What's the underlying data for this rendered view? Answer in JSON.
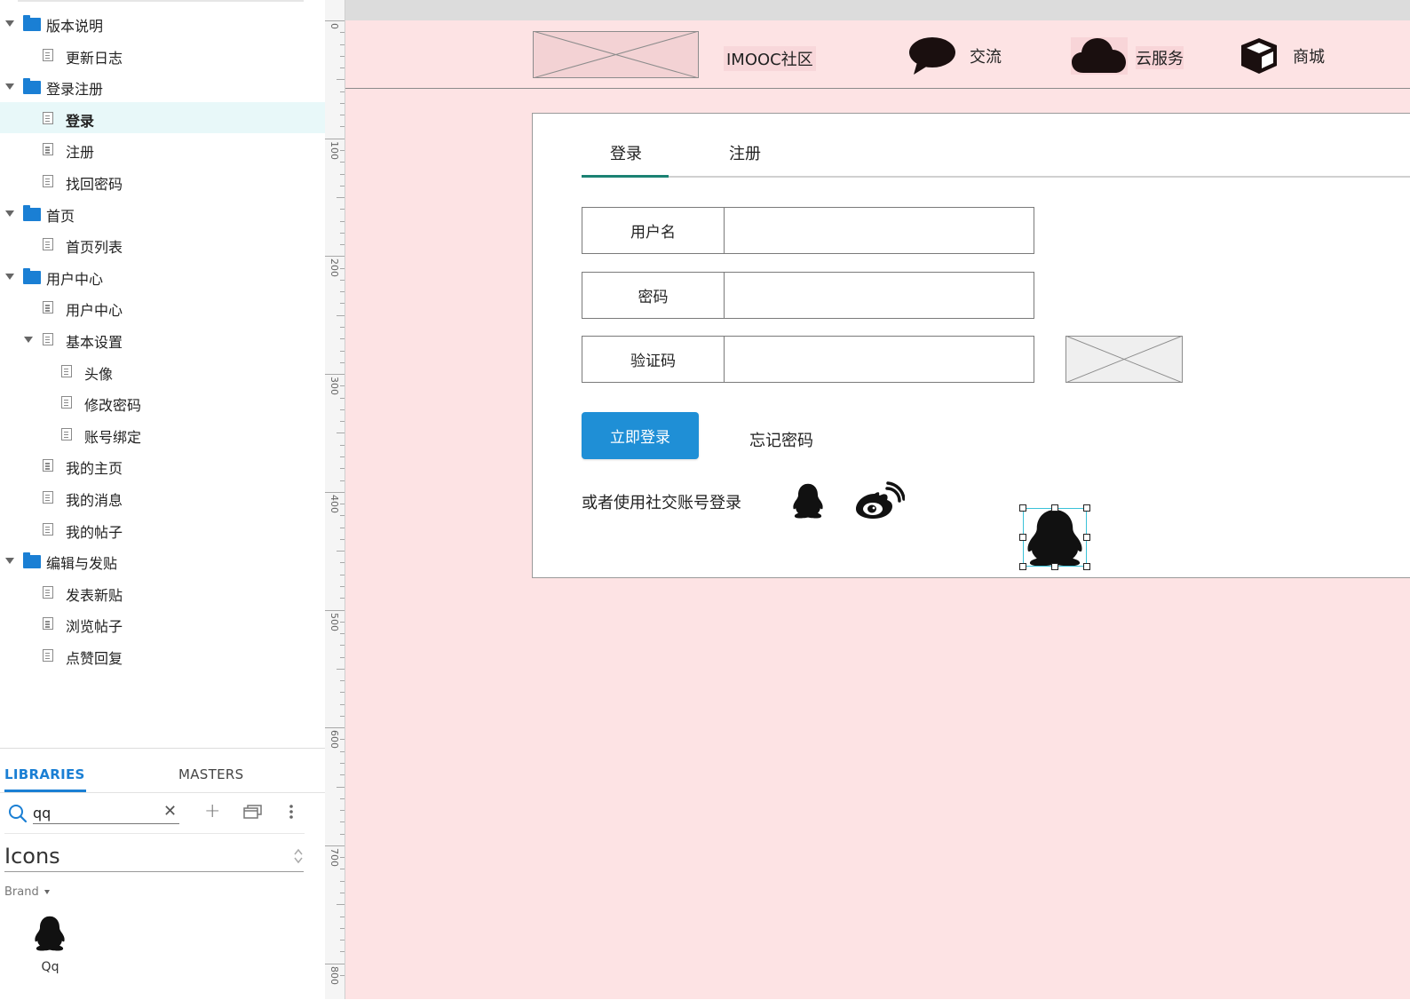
{
  "sidebar": {
    "tree": [
      {
        "label": "版本说明",
        "type": "folder",
        "level": 0,
        "expanded": true
      },
      {
        "label": "更新日志",
        "type": "page",
        "level": 1
      },
      {
        "label": "登录注册",
        "type": "folder",
        "level": 0,
        "expanded": true
      },
      {
        "label": "登录",
        "type": "page",
        "level": 1,
        "selected": true
      },
      {
        "label": "注册",
        "type": "page",
        "level": 1
      },
      {
        "label": "找回密码",
        "type": "page",
        "level": 1
      },
      {
        "label": "首页",
        "type": "folder",
        "level": 0,
        "expanded": true
      },
      {
        "label": "首页列表",
        "type": "page",
        "level": 1
      },
      {
        "label": "用户中心",
        "type": "folder",
        "level": 0,
        "expanded": true
      },
      {
        "label": "用户中心",
        "type": "page",
        "level": 1
      },
      {
        "label": "基本设置",
        "type": "page",
        "level": 1,
        "expanded": true
      },
      {
        "label": "头像",
        "type": "page",
        "level": 2
      },
      {
        "label": "修改密码",
        "type": "page",
        "level": 2
      },
      {
        "label": "账号绑定",
        "type": "page",
        "level": 2
      },
      {
        "label": "我的主页",
        "type": "page",
        "level": 1
      },
      {
        "label": "我的消息",
        "type": "page",
        "level": 1
      },
      {
        "label": "我的帖子",
        "type": "page",
        "level": 1
      },
      {
        "label": "编辑与发贴",
        "type": "folder",
        "level": 0,
        "expanded": true
      },
      {
        "label": "发表新贴",
        "type": "page",
        "level": 1
      },
      {
        "label": "浏览帖子",
        "type": "page",
        "level": 1
      },
      {
        "label": "点赞回复",
        "type": "page",
        "level": 1
      }
    ]
  },
  "library": {
    "tabs": {
      "libraries": "LIBRARIES",
      "masters": "MASTERS"
    },
    "search_value": "qq",
    "selected_library": "Icons",
    "group_label": "Brand",
    "item_label": "Qq",
    "accent": "#1a7fd4"
  },
  "ruler": {
    "labels": [
      "0",
      "100",
      "200",
      "300",
      "400",
      "500",
      "600",
      "700",
      "800"
    ]
  },
  "canvas": {
    "background": "#fde3e4",
    "header": {
      "brand": "IMOOC社区",
      "nav": [
        {
          "label": "交流",
          "icon": "chat-bubble-icon"
        },
        {
          "label": "云服务",
          "icon": "cloud-icon"
        },
        {
          "label": "商城",
          "icon": "cube-icon"
        }
      ]
    },
    "login": {
      "tabs": {
        "login": "登录",
        "register": "注册"
      },
      "fields": {
        "username_label": "用户名",
        "password_label": "密码",
        "captcha_label": "验证码"
      },
      "submit_label": "立即登录",
      "forgot_label": "忘记密码",
      "social_text": "或者使用社交账号登录",
      "button_color": "#1f8fd6",
      "tab_accent": "#1b8273"
    }
  }
}
